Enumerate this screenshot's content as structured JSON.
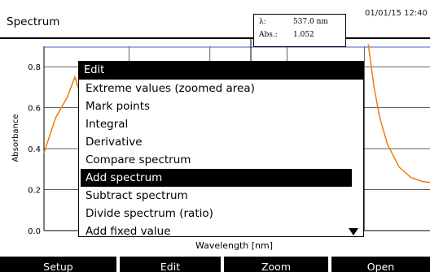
{
  "title_bar": {
    "title": "Spectrum",
    "datetime": "01/01/15 12:40"
  },
  "cursor_readout": {
    "lambda_label": "λ:",
    "lambda_value": "537.0 nm",
    "abs_label": "Abs.:",
    "abs_value": "1.052"
  },
  "chart": {
    "ylabel": "Absorbance",
    "xlabel": "Wavelength [nm]",
    "y_ticks": [
      "0.8",
      "0.6",
      "0.4",
      "0.2",
      "0.0"
    ],
    "line_color": "#f07a0a",
    "cursor_line_color": "#4a5ccf"
  },
  "chart_data": {
    "type": "line",
    "xlabel": "Wavelength [nm]",
    "ylabel": "Absorbance",
    "ylim": [
      0.0,
      0.9
    ],
    "grid": true,
    "series": [
      {
        "points": [
          [
            0.0,
            0.38
          ],
          [
            0.03,
            0.55
          ],
          [
            0.06,
            0.65
          ],
          [
            0.08,
            0.75
          ],
          [
            0.12,
            0.51
          ],
          [
            0.16,
            0.4
          ]
        ]
      },
      {
        "points": [
          [
            0.84,
            0.91
          ],
          [
            0.855,
            0.7
          ],
          [
            0.87,
            0.55
          ],
          [
            0.89,
            0.42
          ],
          [
            0.92,
            0.31
          ],
          [
            0.95,
            0.26
          ],
          [
            0.98,
            0.24
          ],
          [
            1.0,
            0.235
          ]
        ]
      }
    ]
  },
  "menu": {
    "header": "Edit",
    "items": [
      "Extreme values (zoomed area)",
      "Mark points",
      "Integral",
      "Derivative",
      "Compare spectrum",
      "Add spectrum",
      "Subtract spectrum",
      "Divide spectrum (ratio)",
      "Add fixed value"
    ],
    "selected_index": 5
  },
  "softkeys": [
    "Setup",
    "Edit",
    "Zoom",
    "Open"
  ]
}
